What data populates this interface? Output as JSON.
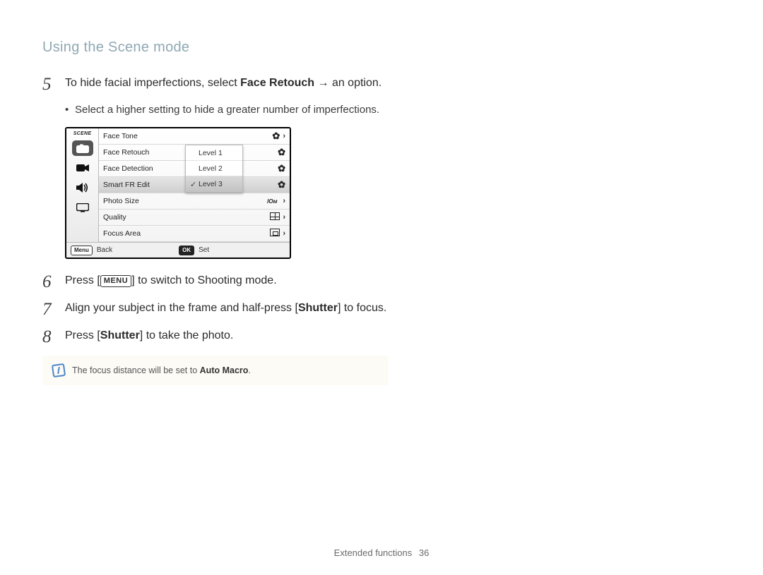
{
  "header": {
    "title": "Using the Scene mode"
  },
  "steps": {
    "s5": {
      "num": "5",
      "text_a": "To hide facial imperfections, select ",
      "bold_a": "Face Retouch",
      "text_b": " → an option.",
      "bullet": "Select a higher setting to hide a greater number of imperfections."
    },
    "s6": {
      "num": "6",
      "text_a": "Press [",
      "btn": "MENU",
      "text_b": "] to switch to Shooting mode."
    },
    "s7": {
      "num": "7",
      "text_a": "Align your subject in the frame and half-press [",
      "bold_a": "Shutter",
      "text_b": "] to focus."
    },
    "s8": {
      "num": "8",
      "text_a": "Press [",
      "bold_a": "Shutter",
      "text_b": "] to take the photo."
    }
  },
  "lcd": {
    "sidebar_label": "SCENE",
    "items": [
      {
        "label": "Face Tone",
        "value_icon": "face-tone"
      },
      {
        "label": "Face Retouch",
        "value_icon": "face-retouch"
      },
      {
        "label": "Face Detection",
        "value_icon": "face-detect"
      },
      {
        "label": "Smart FR Edit",
        "value_icon": "smart-fr",
        "selected": true
      },
      {
        "label": "Photo Size",
        "value_icon": "photo-size"
      },
      {
        "label": "Quality",
        "value_icon": "quality"
      },
      {
        "label": "Focus Area",
        "value_icon": "focus-area"
      }
    ],
    "submenu": [
      {
        "label": "Level 1"
      },
      {
        "label": "Level 2"
      },
      {
        "label": "Level 3",
        "selected": true,
        "checked": true
      }
    ],
    "footer": {
      "back_btn": "Menu",
      "back_label": "Back",
      "set_btn": "OK",
      "set_label": "Set"
    }
  },
  "note": {
    "text_a": "The focus distance will be set to ",
    "bold": "Auto Macro",
    "text_b": "."
  },
  "footer": {
    "section": "Extended functions",
    "page": "36"
  }
}
